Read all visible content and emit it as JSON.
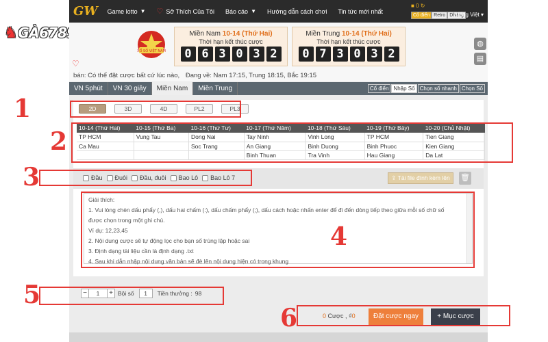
{
  "brand_logo": "GÀ6789",
  "topbar": {
    "logo": "GW",
    "nav": [
      {
        "label": "Game lotto",
        "has_menu": true,
        "icon": ""
      },
      {
        "label": "Sở Thích Của Tôi",
        "has_menu": false,
        "icon": "heart-icon"
      },
      {
        "label": "Báo cáo",
        "has_menu": true,
        "icon": ""
      },
      {
        "label": "Hướng dẫn cách chơi",
        "has_menu": false,
        "icon": ""
      },
      {
        "label": "Tin tức mới nhất",
        "has_menu": false,
        "icon": ""
      }
    ],
    "balance": "0",
    "modes": [
      "Cổ điển",
      "Retro",
      "Dhắng"
    ],
    "active_mode": 0,
    "language": "Tiếng Việt"
  },
  "banner": {
    "emblem_text": "XỔ SỐ VIỆT NAM",
    "timers": [
      {
        "region": "Miền Nam",
        "date": "10-14 (Thứ Hai)",
        "label": "Thời hạn kết thúc cược",
        "digits": [
          "0",
          "6",
          "3",
          "0",
          "3",
          "2"
        ]
      },
      {
        "region": "Miền Trung",
        "date": "10-14 (Thứ Hai)",
        "label": "Thời hạn kết thúc cược",
        "digits": [
          "0",
          "7",
          "3",
          "0",
          "3",
          "2"
        ]
      }
    ]
  },
  "ticker": {
    "notice": "bán: Có thể đặt cược bất cứ lúc nào,",
    "schedule": "Đang về: Nam 17:15, Trung 18:15, Bắc 19:15"
  },
  "tabs": [
    "VN 5phút",
    "VN 30 giây",
    "Miền Nam",
    "Miền Trung"
  ],
  "active_tab": 2,
  "input_modes": [
    "Cổ điển",
    "Nhập Số",
    "Chọn số nhanh",
    "Chọn Số"
  ],
  "active_input_mode": 1,
  "subtabs": [
    "2D",
    "3D",
    "4D",
    "PL2",
    "PL3"
  ],
  "active_subtab": 0,
  "schedule": {
    "headers": [
      "10-14 (Thứ Hai)",
      "10-15 (Thứ Ba)",
      "10-16 (Thứ Tư)",
      "10-17 (Thứ Năm)",
      "10-18 (Thứ Sáu)",
      "10-19 (Thứ Bảy)",
      "10-20 (Chủ Nhật)"
    ],
    "rows": [
      [
        "TP HCM",
        "Vung Tau",
        "Dong Nai",
        "Tay Ninh",
        "Vinh Long",
        "TP HCM",
        "Tien Giang"
      ],
      [
        "Ca Mau",
        "",
        "Soc Trang",
        "An Giang",
        "Binh Duong",
        "Binh Phuoc",
        "Kien Giang"
      ],
      [
        "",
        "",
        "",
        "Binh Thuan",
        "Tra Vinh",
        "Hau Giang",
        "Da Lat"
      ]
    ]
  },
  "checkboxes": [
    "Đầu",
    "Đuôi",
    "Đầu, đuôi",
    "Bao Lô",
    "Bao Lô 7"
  ],
  "upload_label": "Tải file đính kèm lên",
  "instructions": {
    "title": "Giải thích:",
    "lines": [
      "1. Vui lòng chèn dấu phẩy (,), dấu hai chấm (:), dấu chấm phẩy (;), dấu cách hoặc nhấn enter để đi đến dòng tiếp theo giữa mỗi số chữ số",
      "được chọn trong một ghi chú.",
      "Ví dụ: 12,23,45",
      "2. Nội dung cược sẽ tự động lọc cho bạn số trùng lặp hoặc sai",
      "3. Định dạng tài liệu cần là định dạng .txt",
      "4. Sau khi dẫn nhập nội dung văn bản sẽ đè lên nội dung hiện có trong khung"
    ]
  },
  "multiplier": {
    "qty": "1",
    "label": "Bội số",
    "value": "1",
    "reward_label": "Tiền thưởng :",
    "reward": "98"
  },
  "action": {
    "bet_count": "0",
    "bet_label": "Cược ,",
    "amount_symbol": "₫",
    "amount": "0",
    "place_bet": "Đặt cược ngay",
    "bet_list": "Mục cược"
  },
  "annotations": [
    "1",
    "2",
    "3",
    "4",
    "5",
    "6"
  ],
  "colors": {
    "accent_orange": "#ee7f3b",
    "annotation_red": "#e53935",
    "tab_bar": "#5b6770",
    "subtab_active": "#b69c7e"
  }
}
